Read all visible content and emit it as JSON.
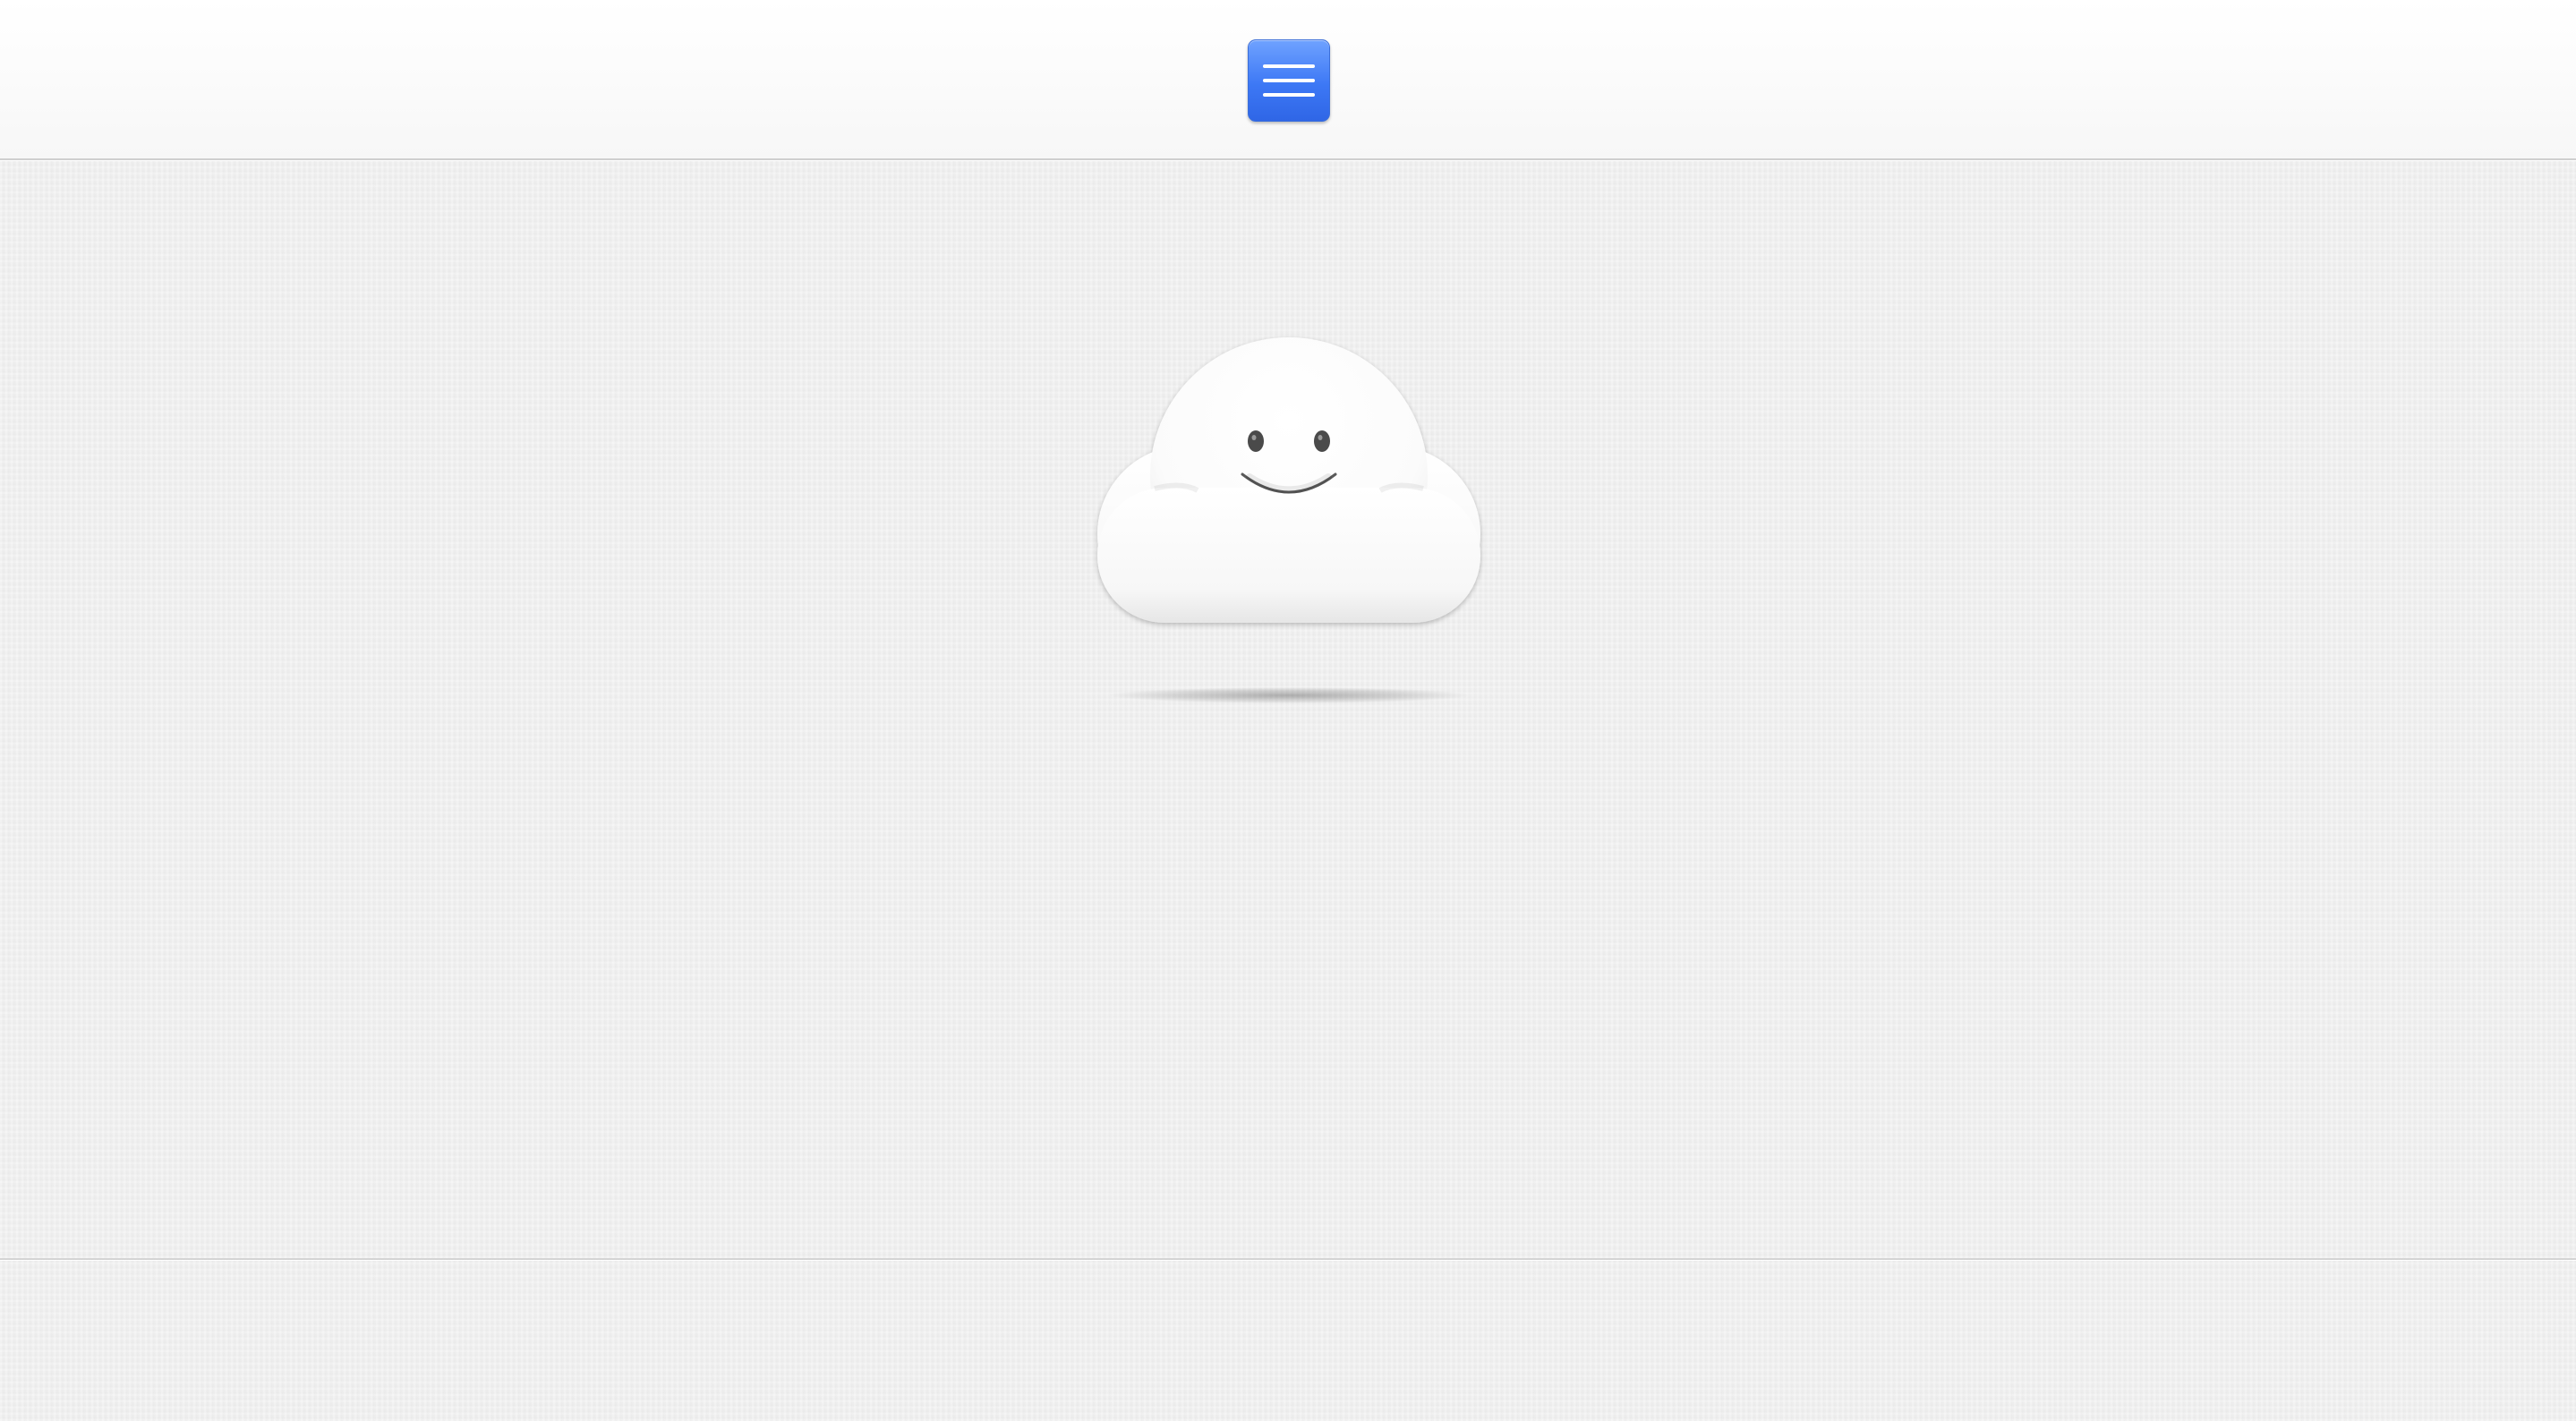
{
  "header": {
    "menu_button": {
      "icon": "hamburger-menu-icon",
      "color": "#3d78f5"
    }
  },
  "main": {
    "mascot": {
      "icon": "smiling-cloud-icon",
      "color": "#ffffff"
    }
  },
  "theme": {
    "background": "#efefef",
    "header_background": "#ffffff"
  }
}
